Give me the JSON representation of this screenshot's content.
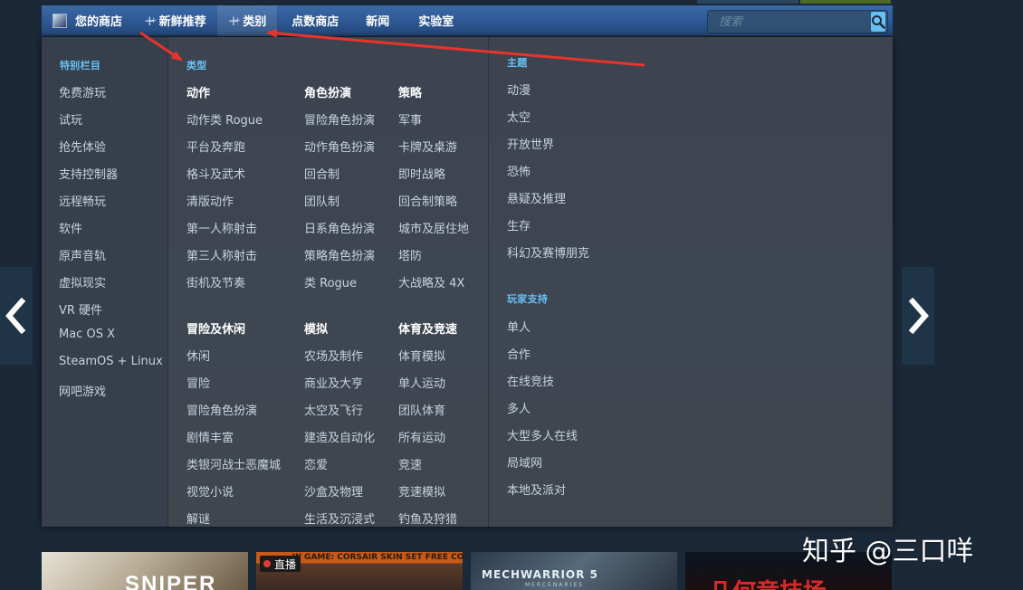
{
  "navbar": {
    "items": [
      {
        "label": "您的商店"
      },
      {
        "label": "新鲜推荐"
      },
      {
        "label": "类别"
      },
      {
        "label": "点数商店"
      },
      {
        "label": "新闻"
      },
      {
        "label": "实验室"
      }
    ],
    "search_placeholder": "搜索"
  },
  "dropdown": {
    "special_heading": "特别栏目",
    "special_items": [
      "免费游玩",
      "试玩",
      "抢先体验",
      "支持控制器",
      "远程畅玩",
      "软件",
      "原声音轨",
      "虚拟现实",
      "VR 硬件",
      "Mac OS X",
      "SteamOS + Linux",
      "网吧游戏"
    ],
    "genre_heading": "类型",
    "genres": [
      {
        "title": "动作",
        "items": [
          "动作类 Rogue",
          "平台及奔跑",
          "格斗及武术",
          "清版动作",
          "第一人称射击",
          "第三人称射击",
          "街机及节奏"
        ]
      },
      {
        "title": "角色扮演",
        "items": [
          "冒险角色扮演",
          "动作角色扮演",
          "回合制",
          "团队制",
          "日系角色扮演",
          "策略角色扮演",
          "类 Rogue"
        ]
      },
      {
        "title": "策略",
        "items": [
          "军事",
          "卡牌及桌游",
          "即时战略",
          "回合制策略",
          "城市及居住地",
          "塔防",
          "大战略及 4X"
        ]
      },
      {
        "title": "冒险及休闲",
        "items": [
          "休闲",
          "冒险",
          "冒险角色扮演",
          "剧情丰富",
          "类银河战士恶魔城",
          "视觉小说",
          "解谜"
        ]
      },
      {
        "title": "模拟",
        "items": [
          "农场及制作",
          "商业及大亨",
          "太空及飞行",
          "建造及自动化",
          "恋爱",
          "沙盒及物理",
          "生活及沉浸式"
        ]
      },
      {
        "title": "体育及竞速",
        "items": [
          "体育模拟",
          "单人运动",
          "团队体育",
          "所有运动",
          "竞速",
          "竞速模拟",
          "钓鱼及狩猎"
        ]
      }
    ],
    "theme_heading": "主题",
    "themes": [
      "动漫",
      "太空",
      "开放世界",
      "恐怖",
      "悬疑及推理",
      "生存",
      "科幻及赛博朋克"
    ],
    "player_heading": "玩家支持",
    "player_items": [
      "单人",
      "合作",
      "在线竞技",
      "多人",
      "大型多人在线",
      "局域网",
      "本地及派对"
    ]
  },
  "capsules": {
    "c1_text": "SNIPER",
    "c2_banner": "W GAME: CORSAIR SKIN SET FREE CONTENT",
    "c2_live": "直播",
    "c3_text": "MECHWARRIOR 5",
    "c3_sub": "MERCENARIES",
    "c4_text": "几何竞技场"
  },
  "watermark": "知乎 @三口咩",
  "colors": {
    "accent": "#67c1f5",
    "nav": "#2f5b96",
    "dropdown": "#3d4450",
    "arrow": "#e8342a"
  }
}
